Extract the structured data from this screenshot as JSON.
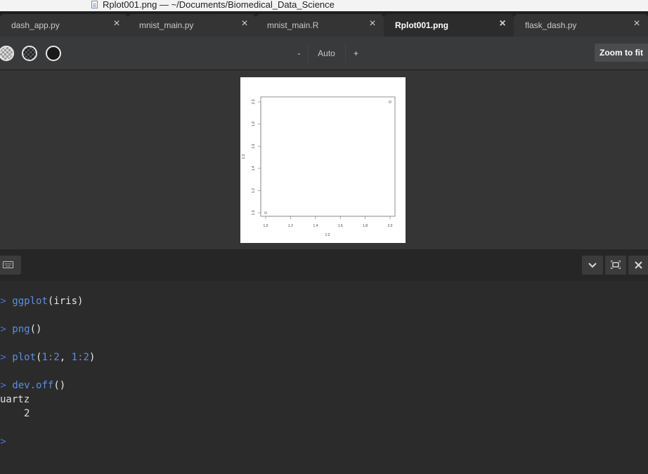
{
  "window": {
    "title": "Rplot001.png — ~/Documents/Biomedical_Data_Science",
    "file_icon": "image-file-icon"
  },
  "tabs": [
    {
      "label": "dash_app.py",
      "active": false
    },
    {
      "label": "mnist_main.py",
      "active": false
    },
    {
      "label": "mnist_main.R",
      "active": false
    },
    {
      "label": "Rplot001.png",
      "active": true
    },
    {
      "label": "flask_dash.py",
      "active": false
    }
  ],
  "toolbar": {
    "zoom_out": "-",
    "zoom_level": "Auto",
    "zoom_in": "+",
    "zoom_to_fit": "Zoom to fit"
  },
  "plot": {
    "x_label": "1:2",
    "y_label": "1:2",
    "x_ticks": [
      "1.0",
      "1.2",
      "1.4",
      "1.6",
      "1.8",
      "2.0"
    ],
    "y_ticks": [
      "1.0",
      "1.2",
      "1.4",
      "1.6",
      "1.8",
      "2.0"
    ],
    "points": [
      {
        "x": 1,
        "y": 1
      },
      {
        "x": 2,
        "y": 2
      }
    ]
  },
  "console": {
    "prompt": "$>",
    "lines": [
      {
        "fn": "ggplot",
        "args": "(iris)"
      },
      {
        "fn": "png",
        "args": "()"
      },
      {
        "fn": "plot",
        "args": "(1:2, 1:2)"
      },
      {
        "fn": "dev.off",
        "args": "()"
      }
    ],
    "output_name": "uartz",
    "output_value": "2"
  },
  "colors": {
    "prompt": "#4a6fe0",
    "function": "#5b8ee6",
    "background": "#2b2b2b"
  }
}
